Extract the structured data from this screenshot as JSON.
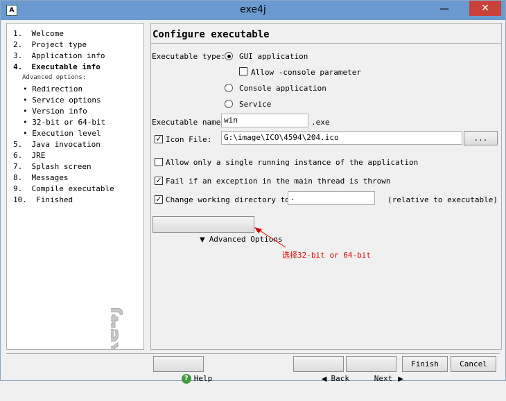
{
  "window": {
    "title": "exe4j",
    "app_icon": "A",
    "minimize": "—",
    "close": "✕"
  },
  "sidebar": {
    "steps": [
      {
        "label": "1.  Welcome"
      },
      {
        "label": "2.  Project type"
      },
      {
        "label": "3.  Application info"
      },
      {
        "label": "4.  Executable info"
      },
      {
        "label": "5.  Java invocation"
      },
      {
        "label": "6.  JRE"
      },
      {
        "label": "7.  Splash screen"
      },
      {
        "label": "8.  Messages"
      },
      {
        "label": "9.  Compile executable"
      },
      {
        "label": "10.  Finished"
      }
    ],
    "advanced_heading": "Advanced options:",
    "advanced": [
      {
        "label": "• Redirection"
      },
      {
        "label": "• Service options"
      },
      {
        "label": "• Version info"
      },
      {
        "label": "• 32-bit or 64-bit"
      },
      {
        "label": "• Execution level"
      }
    ],
    "logo_text": "exe4j"
  },
  "main": {
    "heading": "Configure executable",
    "exe_type_label": "Executable type:",
    "gui_label": "GUI application",
    "console_param_label": "Allow -console parameter",
    "console_label": "Console application",
    "service_label": "Service",
    "exe_name_label": "Executable name:",
    "exe_name_value": "win",
    "exe_suffix": ".exe",
    "icon_label": "Icon File:",
    "icon_value": "G:\\image\\ICO\\4594\\204.ico",
    "browse_label": "...",
    "single_instance_label": "Allow only a single running instance of the application",
    "fail_exception_label": "Fail if an exception in the main thread is thrown",
    "change_dir_label": "Change working directory to:",
    "change_dir_value": ".",
    "relative_label": "(relative to executable)",
    "advanced_btn_label": "Advanced Options",
    "check_mark": "✓"
  },
  "annotation": {
    "text": "选择32-bit or 64-bit",
    "color": "#e00000"
  },
  "footer": {
    "help": "Help",
    "back": "Back",
    "next": "Next",
    "finish": "Finish",
    "cancel": "Cancel"
  },
  "colors": {
    "titlebar": "#6a9ad0",
    "close": "#c7423b",
    "annotation": "#e00000"
  }
}
